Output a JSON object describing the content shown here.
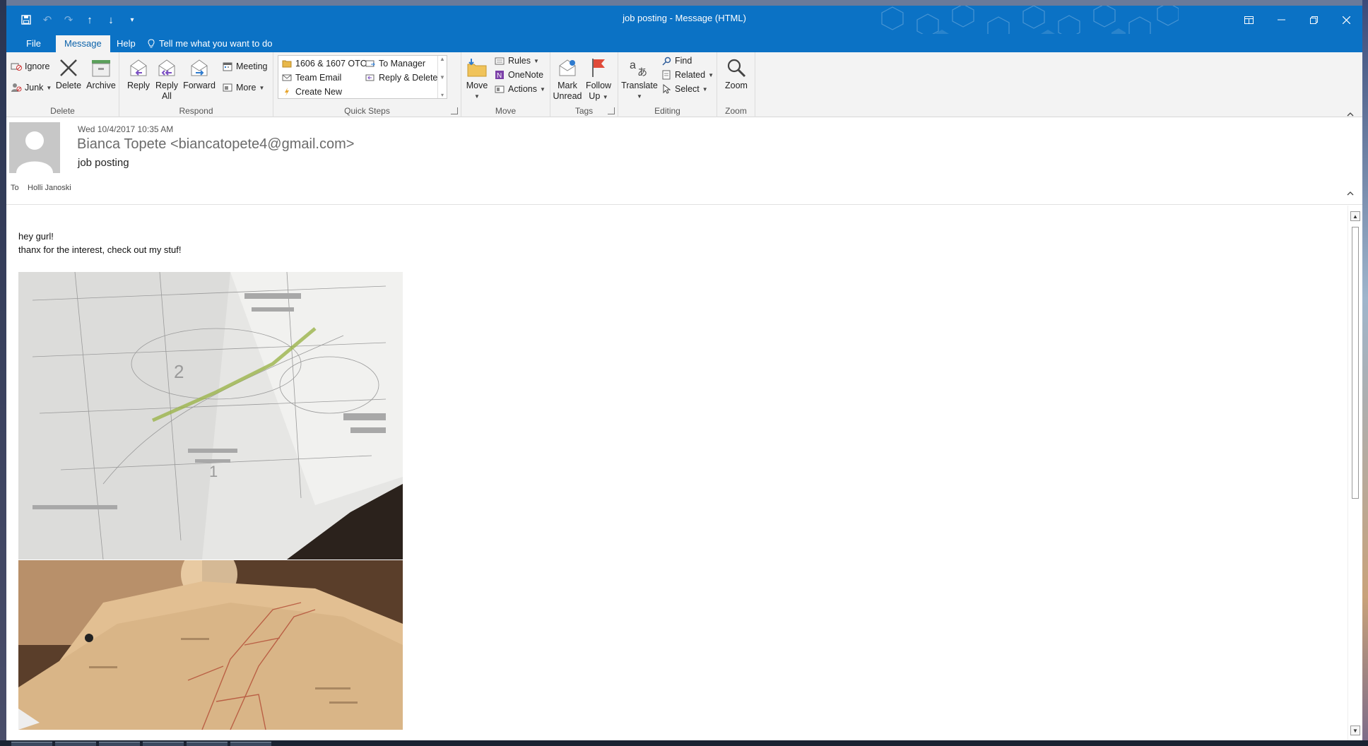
{
  "window": {
    "title": "job posting  -  Message (HTML)"
  },
  "tabs": {
    "file": "File",
    "message": "Message",
    "help": "Help",
    "tell_me": "Tell me what you want to do"
  },
  "ribbon": {
    "delete_group": {
      "label": "Delete",
      "ignore": "Ignore",
      "junk": "Junk",
      "delete": "Delete",
      "archive": "Archive"
    },
    "respond_group": {
      "label": "Respond",
      "reply": "Reply",
      "reply_all_line1": "Reply",
      "reply_all_line2": "All",
      "forward": "Forward",
      "meeting": "Meeting",
      "more": "More"
    },
    "quick_steps_group": {
      "label": "Quick Steps",
      "items": [
        "1606 & 1607 OTC",
        "To Manager",
        "Team Email",
        "Reply & Delete",
        "Create New"
      ]
    },
    "move_group": {
      "label": "Move",
      "move": "Move",
      "rules": "Rules",
      "onenote": "OneNote",
      "actions": "Actions"
    },
    "tags_group": {
      "label": "Tags",
      "mark_unread_line1": "Mark",
      "mark_unread_line2": "Unread",
      "follow_up_line1": "Follow",
      "follow_up_line2": "Up"
    },
    "editing_group": {
      "label": "Editing",
      "translate": "Translate",
      "find": "Find",
      "related": "Related",
      "select": "Select"
    },
    "zoom_group": {
      "label": "Zoom",
      "zoom": "Zoom"
    }
  },
  "message": {
    "date": "Wed 10/4/2017 10:35 AM",
    "sender": "Bianca Topete <biancatopete4@gmail.com>",
    "subject": "job posting",
    "to_label": "To",
    "to_name": "Holli Janoski",
    "body_line1": "hey gurl!",
    "body_line2": "thanx for the interest, check out my stuf!"
  },
  "colors": {
    "accent": "#0b72c5",
    "ribbon_bg": "#f3f3f3"
  }
}
